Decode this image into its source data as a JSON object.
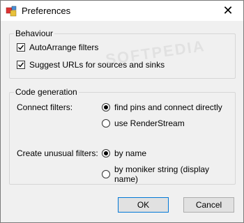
{
  "window": {
    "title": "Preferences"
  },
  "behaviour": {
    "title": "Behaviour",
    "autoarrange": {
      "label": "AutoArrange filters",
      "checked": true
    },
    "suggest_urls": {
      "label": "Suggest URLs for sources and sinks",
      "checked": true
    }
  },
  "code_generation": {
    "title": "Code generation",
    "connect_filters": {
      "label": "Connect filters:",
      "options": [
        {
          "label": "find pins and connect directly",
          "selected": true
        },
        {
          "label": "use RenderStream",
          "selected": false
        }
      ]
    },
    "unusual_filters": {
      "label": "Create unusual filters:",
      "options": [
        {
          "label": "by name",
          "selected": true
        },
        {
          "label": "by moniker string (display name)",
          "selected": false
        }
      ]
    }
  },
  "buttons": {
    "ok": "OK",
    "cancel": "Cancel"
  },
  "watermark": "SOFTPEDIA"
}
